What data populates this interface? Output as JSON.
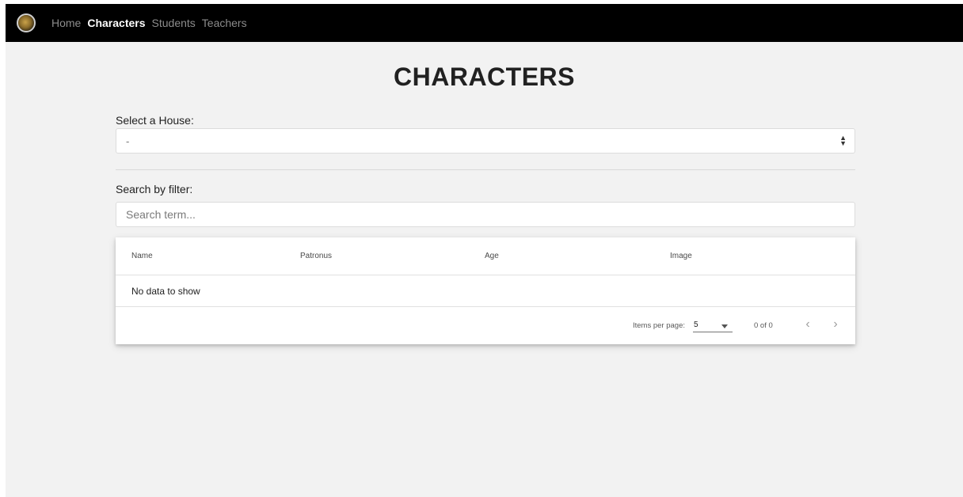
{
  "nav": {
    "logo_icon": "house-crest-icon",
    "links": [
      "Home",
      "Characters",
      "Students",
      "Teachers"
    ],
    "active": "Characters"
  },
  "page": {
    "title": "CHARACTERS"
  },
  "house_select": {
    "label": "Select a House:",
    "value": "-"
  },
  "filter": {
    "label": "Search by filter:",
    "placeholder": "Search term..."
  },
  "table": {
    "columns": [
      "Name",
      "Patronus",
      "Age",
      "Image"
    ],
    "empty_text": "No data to show"
  },
  "paginator": {
    "items_per_page_label": "Items per page:",
    "page_size": "5",
    "range": "0 of 0"
  },
  "colors": {
    "navbar": "#000000",
    "background": "#f2f2f2",
    "active_link": "#ffffff",
    "inactive_link": "#8c8c8c"
  }
}
